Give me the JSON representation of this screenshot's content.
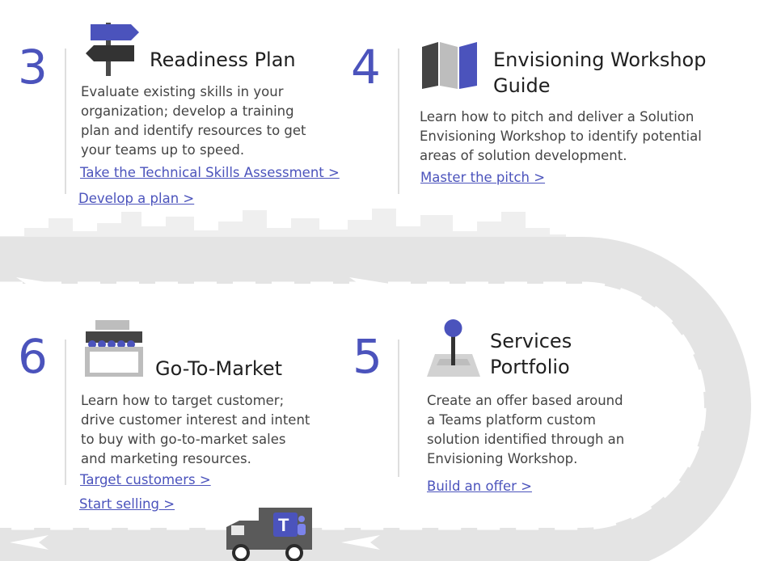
{
  "steps": {
    "s3": {
      "number": "3",
      "title": "Readiness Plan",
      "desc": [
        "Evaluate existing skills in your",
        "organization; develop a training",
        "plan and identify resources to get",
        "your teams up to speed."
      ],
      "links": [
        "Take the Technical Skills Assessment >",
        "Develop a plan >"
      ],
      "icon": "signpost-icon"
    },
    "s4": {
      "number": "4",
      "title": [
        "Envisioning Workshop",
        "Guide"
      ],
      "desc": [
        "Learn how to pitch and deliver a Solution",
        "Envisioning Workshop to identify potential",
        "areas of solution development."
      ],
      "links": [
        "Master the pitch >"
      ],
      "icon": "map-icon"
    },
    "s6": {
      "number": "6",
      "title": "Go-To-Market",
      "desc": [
        "Learn how to target customer;",
        "drive customer interest and intent",
        "to buy with go-to-market sales",
        "and marketing resources."
      ],
      "links": [
        "Target customers >",
        "Start selling >"
      ],
      "icon": "storefront-icon"
    },
    "s5": {
      "number": "5",
      "title": [
        "Services",
        "Portfolio"
      ],
      "desc": [
        "Create an offer based around",
        "a Teams platform custom",
        "solution identified through an",
        "Envisioning Workshop."
      ],
      "links": [
        "Build an offer >"
      ],
      "icon": "map-pin-icon"
    }
  },
  "colors": {
    "accent": "#4b53bc",
    "road": "#e6e6e6",
    "skyline": "#eeeeee",
    "dark": "#4a4a4a"
  },
  "decor": {
    "truck_icon": "delivery-truck-icon",
    "teams_logo": "teams-logo-icon"
  }
}
